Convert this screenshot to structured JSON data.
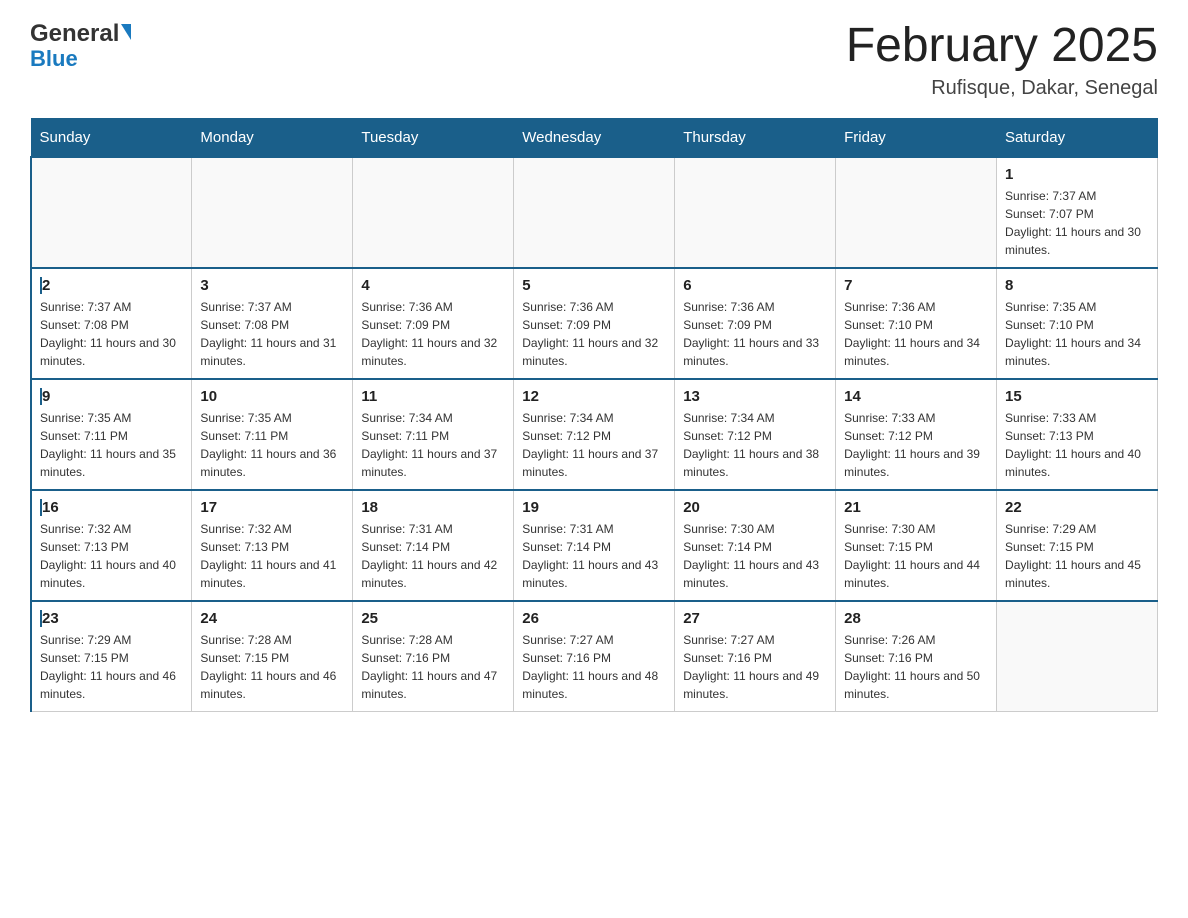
{
  "header": {
    "logo_general": "General",
    "logo_blue": "Blue",
    "month_title": "February 2025",
    "location": "Rufisque, Dakar, Senegal"
  },
  "days_of_week": [
    "Sunday",
    "Monday",
    "Tuesday",
    "Wednesday",
    "Thursday",
    "Friday",
    "Saturday"
  ],
  "weeks": [
    [
      {
        "day": "",
        "sunrise": "",
        "sunset": "",
        "daylight": ""
      },
      {
        "day": "",
        "sunrise": "",
        "sunset": "",
        "daylight": ""
      },
      {
        "day": "",
        "sunrise": "",
        "sunset": "",
        "daylight": ""
      },
      {
        "day": "",
        "sunrise": "",
        "sunset": "",
        "daylight": ""
      },
      {
        "day": "",
        "sunrise": "",
        "sunset": "",
        "daylight": ""
      },
      {
        "day": "",
        "sunrise": "",
        "sunset": "",
        "daylight": ""
      },
      {
        "day": "1",
        "sunrise": "Sunrise: 7:37 AM",
        "sunset": "Sunset: 7:07 PM",
        "daylight": "Daylight: 11 hours and 30 minutes."
      }
    ],
    [
      {
        "day": "2",
        "sunrise": "Sunrise: 7:37 AM",
        "sunset": "Sunset: 7:08 PM",
        "daylight": "Daylight: 11 hours and 30 minutes."
      },
      {
        "day": "3",
        "sunrise": "Sunrise: 7:37 AM",
        "sunset": "Sunset: 7:08 PM",
        "daylight": "Daylight: 11 hours and 31 minutes."
      },
      {
        "day": "4",
        "sunrise": "Sunrise: 7:36 AM",
        "sunset": "Sunset: 7:09 PM",
        "daylight": "Daylight: 11 hours and 32 minutes."
      },
      {
        "day": "5",
        "sunrise": "Sunrise: 7:36 AM",
        "sunset": "Sunset: 7:09 PM",
        "daylight": "Daylight: 11 hours and 32 minutes."
      },
      {
        "day": "6",
        "sunrise": "Sunrise: 7:36 AM",
        "sunset": "Sunset: 7:09 PM",
        "daylight": "Daylight: 11 hours and 33 minutes."
      },
      {
        "day": "7",
        "sunrise": "Sunrise: 7:36 AM",
        "sunset": "Sunset: 7:10 PM",
        "daylight": "Daylight: 11 hours and 34 minutes."
      },
      {
        "day": "8",
        "sunrise": "Sunrise: 7:35 AM",
        "sunset": "Sunset: 7:10 PM",
        "daylight": "Daylight: 11 hours and 34 minutes."
      }
    ],
    [
      {
        "day": "9",
        "sunrise": "Sunrise: 7:35 AM",
        "sunset": "Sunset: 7:11 PM",
        "daylight": "Daylight: 11 hours and 35 minutes."
      },
      {
        "day": "10",
        "sunrise": "Sunrise: 7:35 AM",
        "sunset": "Sunset: 7:11 PM",
        "daylight": "Daylight: 11 hours and 36 minutes."
      },
      {
        "day": "11",
        "sunrise": "Sunrise: 7:34 AM",
        "sunset": "Sunset: 7:11 PM",
        "daylight": "Daylight: 11 hours and 37 minutes."
      },
      {
        "day": "12",
        "sunrise": "Sunrise: 7:34 AM",
        "sunset": "Sunset: 7:12 PM",
        "daylight": "Daylight: 11 hours and 37 minutes."
      },
      {
        "day": "13",
        "sunrise": "Sunrise: 7:34 AM",
        "sunset": "Sunset: 7:12 PM",
        "daylight": "Daylight: 11 hours and 38 minutes."
      },
      {
        "day": "14",
        "sunrise": "Sunrise: 7:33 AM",
        "sunset": "Sunset: 7:12 PM",
        "daylight": "Daylight: 11 hours and 39 minutes."
      },
      {
        "day": "15",
        "sunrise": "Sunrise: 7:33 AM",
        "sunset": "Sunset: 7:13 PM",
        "daylight": "Daylight: 11 hours and 40 minutes."
      }
    ],
    [
      {
        "day": "16",
        "sunrise": "Sunrise: 7:32 AM",
        "sunset": "Sunset: 7:13 PM",
        "daylight": "Daylight: 11 hours and 40 minutes."
      },
      {
        "day": "17",
        "sunrise": "Sunrise: 7:32 AM",
        "sunset": "Sunset: 7:13 PM",
        "daylight": "Daylight: 11 hours and 41 minutes."
      },
      {
        "day": "18",
        "sunrise": "Sunrise: 7:31 AM",
        "sunset": "Sunset: 7:14 PM",
        "daylight": "Daylight: 11 hours and 42 minutes."
      },
      {
        "day": "19",
        "sunrise": "Sunrise: 7:31 AM",
        "sunset": "Sunset: 7:14 PM",
        "daylight": "Daylight: 11 hours and 43 minutes."
      },
      {
        "day": "20",
        "sunrise": "Sunrise: 7:30 AM",
        "sunset": "Sunset: 7:14 PM",
        "daylight": "Daylight: 11 hours and 43 minutes."
      },
      {
        "day": "21",
        "sunrise": "Sunrise: 7:30 AM",
        "sunset": "Sunset: 7:15 PM",
        "daylight": "Daylight: 11 hours and 44 minutes."
      },
      {
        "day": "22",
        "sunrise": "Sunrise: 7:29 AM",
        "sunset": "Sunset: 7:15 PM",
        "daylight": "Daylight: 11 hours and 45 minutes."
      }
    ],
    [
      {
        "day": "23",
        "sunrise": "Sunrise: 7:29 AM",
        "sunset": "Sunset: 7:15 PM",
        "daylight": "Daylight: 11 hours and 46 minutes."
      },
      {
        "day": "24",
        "sunrise": "Sunrise: 7:28 AM",
        "sunset": "Sunset: 7:15 PM",
        "daylight": "Daylight: 11 hours and 46 minutes."
      },
      {
        "day": "25",
        "sunrise": "Sunrise: 7:28 AM",
        "sunset": "Sunset: 7:16 PM",
        "daylight": "Daylight: 11 hours and 47 minutes."
      },
      {
        "day": "26",
        "sunrise": "Sunrise: 7:27 AM",
        "sunset": "Sunset: 7:16 PM",
        "daylight": "Daylight: 11 hours and 48 minutes."
      },
      {
        "day": "27",
        "sunrise": "Sunrise: 7:27 AM",
        "sunset": "Sunset: 7:16 PM",
        "daylight": "Daylight: 11 hours and 49 minutes."
      },
      {
        "day": "28",
        "sunrise": "Sunrise: 7:26 AM",
        "sunset": "Sunset: 7:16 PM",
        "daylight": "Daylight: 11 hours and 50 minutes."
      },
      {
        "day": "",
        "sunrise": "",
        "sunset": "",
        "daylight": ""
      }
    ]
  ]
}
